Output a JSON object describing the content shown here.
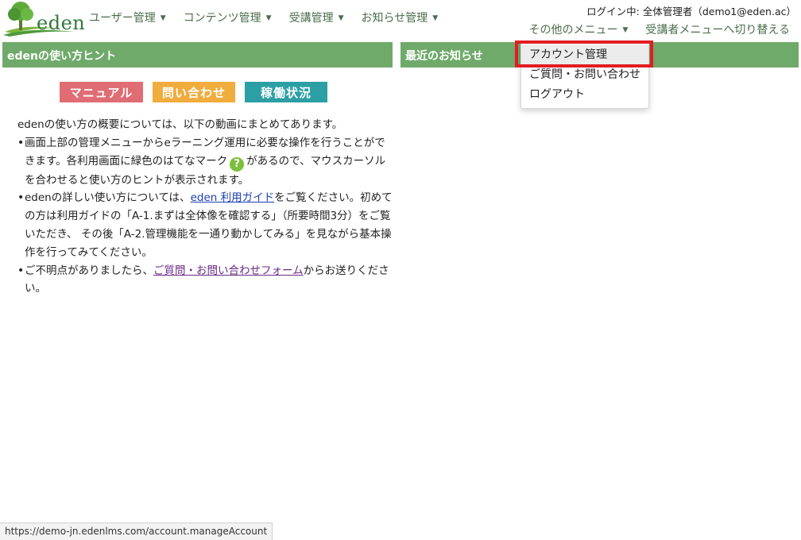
{
  "header": {
    "logo_text": "eden",
    "nav": [
      {
        "label": "ユーザー管理"
      },
      {
        "label": "コンテンツ管理"
      },
      {
        "label": "受講管理"
      },
      {
        "label": "お知らせ管理"
      }
    ],
    "login_info": "ログイン中: 全体管理者（demo1@eden.ac）",
    "other_menu": "その他のメニュー",
    "switch_menu": "受講者メニューへ切り替える"
  },
  "dropdown": {
    "items": [
      {
        "label": "アカウント管理"
      },
      {
        "label": "ご質問・お問い合わせ"
      },
      {
        "label": "ログアウト"
      }
    ]
  },
  "hint_panel": {
    "title": "edenの使い方ヒント",
    "buttons": {
      "manual": "マニュアル",
      "contact": "問い合わせ",
      "status": "稼働状況"
    },
    "intro": "edenの使い方の概要については、以下の動画にまとめてあります。",
    "bullet1_a": "画面上部の管理メニューからeラーニング運用に必要な操作を行うことができます。各利用画面に緑色のはてなマーク",
    "bullet1_q": "?",
    "bullet1_b": "があるので、マウスカーソルを合わせると使い方のヒントが表示されます。",
    "bullet2_a": "edenの詳しい使い方については、",
    "bullet2_link": "eden 利用ガイド",
    "bullet2_b": "をご覧ください。初めての方は利用ガイドの「A-1.まずは全体像を確認する」（所要時間3分）をご覧いただき、 その後「A-2.管理機能を一通り動かしてみる」を見ながら基本操作を行ってみてください。",
    "bullet3_a": "ご不明点がありましたら、",
    "bullet3_link": "ご質問・お問い合わせフォーム",
    "bullet3_b": "からお送りください。"
  },
  "news_panel": {
    "title": "最近のお知らせ"
  },
  "statusbar": {
    "url": "https://demo-jn.edenlms.com/account.manageAccount"
  },
  "colors": {
    "panel_header": "#6faa6a",
    "nav_text": "#4a6d4c",
    "highlight": "#e21d23"
  }
}
